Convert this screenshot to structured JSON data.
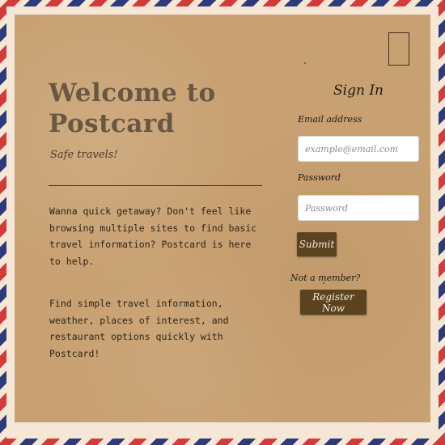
{
  "hero": {
    "title": "Welcome to Postcard",
    "tagline": "Safe travels!",
    "paragraphs": [
      "Wanna quick getaway? Don't feel like browsing multiple sites to find basic travel information? Postcard is here to help.",
      "Find simple travel information, weather, places of interest, and restaurant options quickly with Postcard!"
    ]
  },
  "signin": {
    "title": "Sign In",
    "email_label": "Email address",
    "email_placeholder": "example@email.com",
    "password_label": "Password",
    "password_placeholder": "Password",
    "submit_label": "Submit",
    "not_member_label": "Not a member?",
    "register_label": "Register Now"
  },
  "colors": {
    "paper": "#c8a172",
    "button": "#5b4320",
    "stripe_red": "#d33a3a",
    "stripe_blue": "#2e3b7a"
  }
}
